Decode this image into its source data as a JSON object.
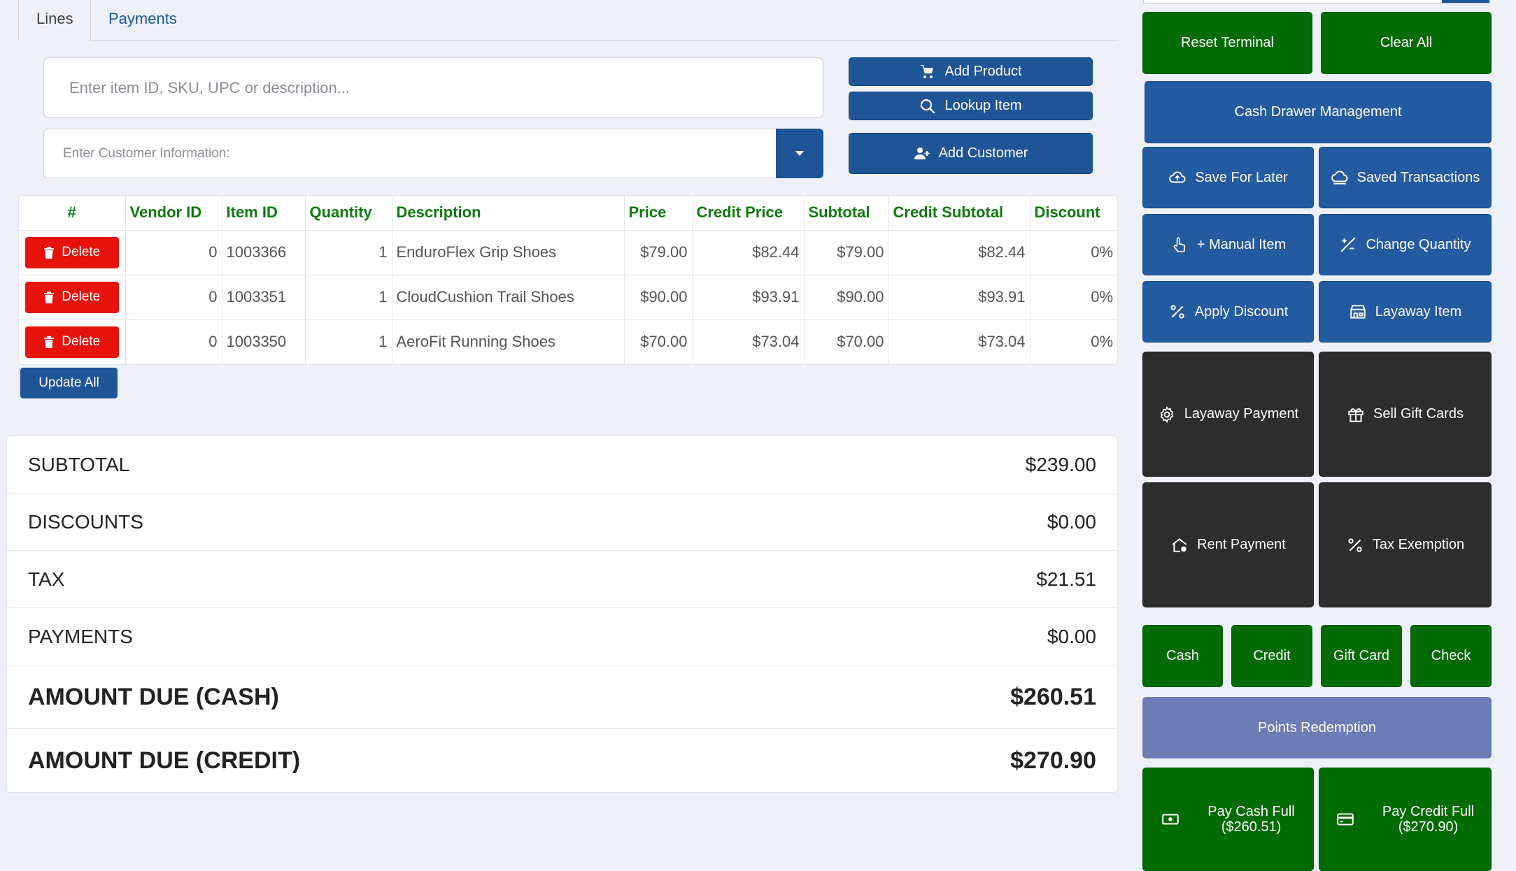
{
  "tabs": [
    {
      "label": "Lines"
    },
    {
      "label": "Payments"
    }
  ],
  "search": {
    "placeholder": "Enter item ID, SKU, UPC or description..."
  },
  "customer": {
    "placeholder": "Enter Customer Information:"
  },
  "actions": {
    "add_product": "Add Product",
    "lookup_item": "Lookup Item",
    "add_customer": "Add Customer"
  },
  "table": {
    "headers": [
      "#",
      "Vendor ID",
      "Item ID",
      "Quantity",
      "Description",
      "Price",
      "Credit Price",
      "Subtotal",
      "Credit Subtotal",
      "Discount"
    ],
    "delete_label": "Delete",
    "rows": [
      {
        "vendor_id": "0",
        "item_id": "1003366",
        "quantity": "1",
        "description": "EnduroFlex Grip Shoes",
        "price": "$79.00",
        "credit_price": "$82.44",
        "subtotal": "$79.00",
        "credit_subtotal": "$82.44",
        "discount": "0%"
      },
      {
        "vendor_id": "0",
        "item_id": "1003351",
        "quantity": "1",
        "description": "CloudCushion Trail Shoes",
        "price": "$90.00",
        "credit_price": "$93.91",
        "subtotal": "$90.00",
        "credit_subtotal": "$93.91",
        "discount": "0%"
      },
      {
        "vendor_id": "0",
        "item_id": "1003350",
        "quantity": "1",
        "description": "AeroFit Running Shoes",
        "price": "$70.00",
        "credit_price": "$73.04",
        "subtotal": "$70.00",
        "credit_subtotal": "$73.04",
        "discount": "0%"
      }
    ],
    "update_all": "Update All"
  },
  "totals": [
    {
      "label": "SUBTOTAL",
      "value": "$239.00"
    },
    {
      "label": "DISCOUNTS",
      "value": "$0.00"
    },
    {
      "label": "TAX",
      "value": "$21.51"
    },
    {
      "label": "PAYMENTS",
      "value": "$0.00"
    },
    {
      "label": "AMOUNT DUE (CASH)",
      "value": "$260.51"
    },
    {
      "label": "AMOUNT DUE (CREDIT)",
      "value": "$270.90"
    }
  ],
  "panel": {
    "reset_terminal": "Reset Terminal",
    "clear_all": "Clear All",
    "cash_drawer": "Cash Drawer Management",
    "save_for_later": "Save For Later",
    "saved_transactions": "Saved Transactions",
    "manual_item": "+ Manual Item",
    "change_quantity": "Change Quantity",
    "apply_discount": "Apply Discount",
    "layaway_item": "Layaway Item",
    "layaway_payment": "Layaway Payment",
    "sell_gift_cards": "Sell Gift Cards",
    "rent_payment": "Rent Payment",
    "tax_exemption": "Tax Exemption",
    "cash": "Cash",
    "credit": "Credit",
    "gift_card": "Gift Card",
    "check": "Check",
    "points_redemption": "Points Redemption",
    "pay_cash_full": "Pay Cash Full",
    "pay_cash_full_amount": "($260.51)",
    "pay_credit_full": "Pay Credit Full",
    "pay_credit_full_amount": "($270.90)"
  },
  "colors": {
    "primary_blue": "#1f5596",
    "action_green": "#036b03",
    "delete_red": "#e8120c",
    "dark_tile": "#2d2d2d",
    "points_purple": "#6d7cb5",
    "header_green": "#0f7a0f"
  }
}
